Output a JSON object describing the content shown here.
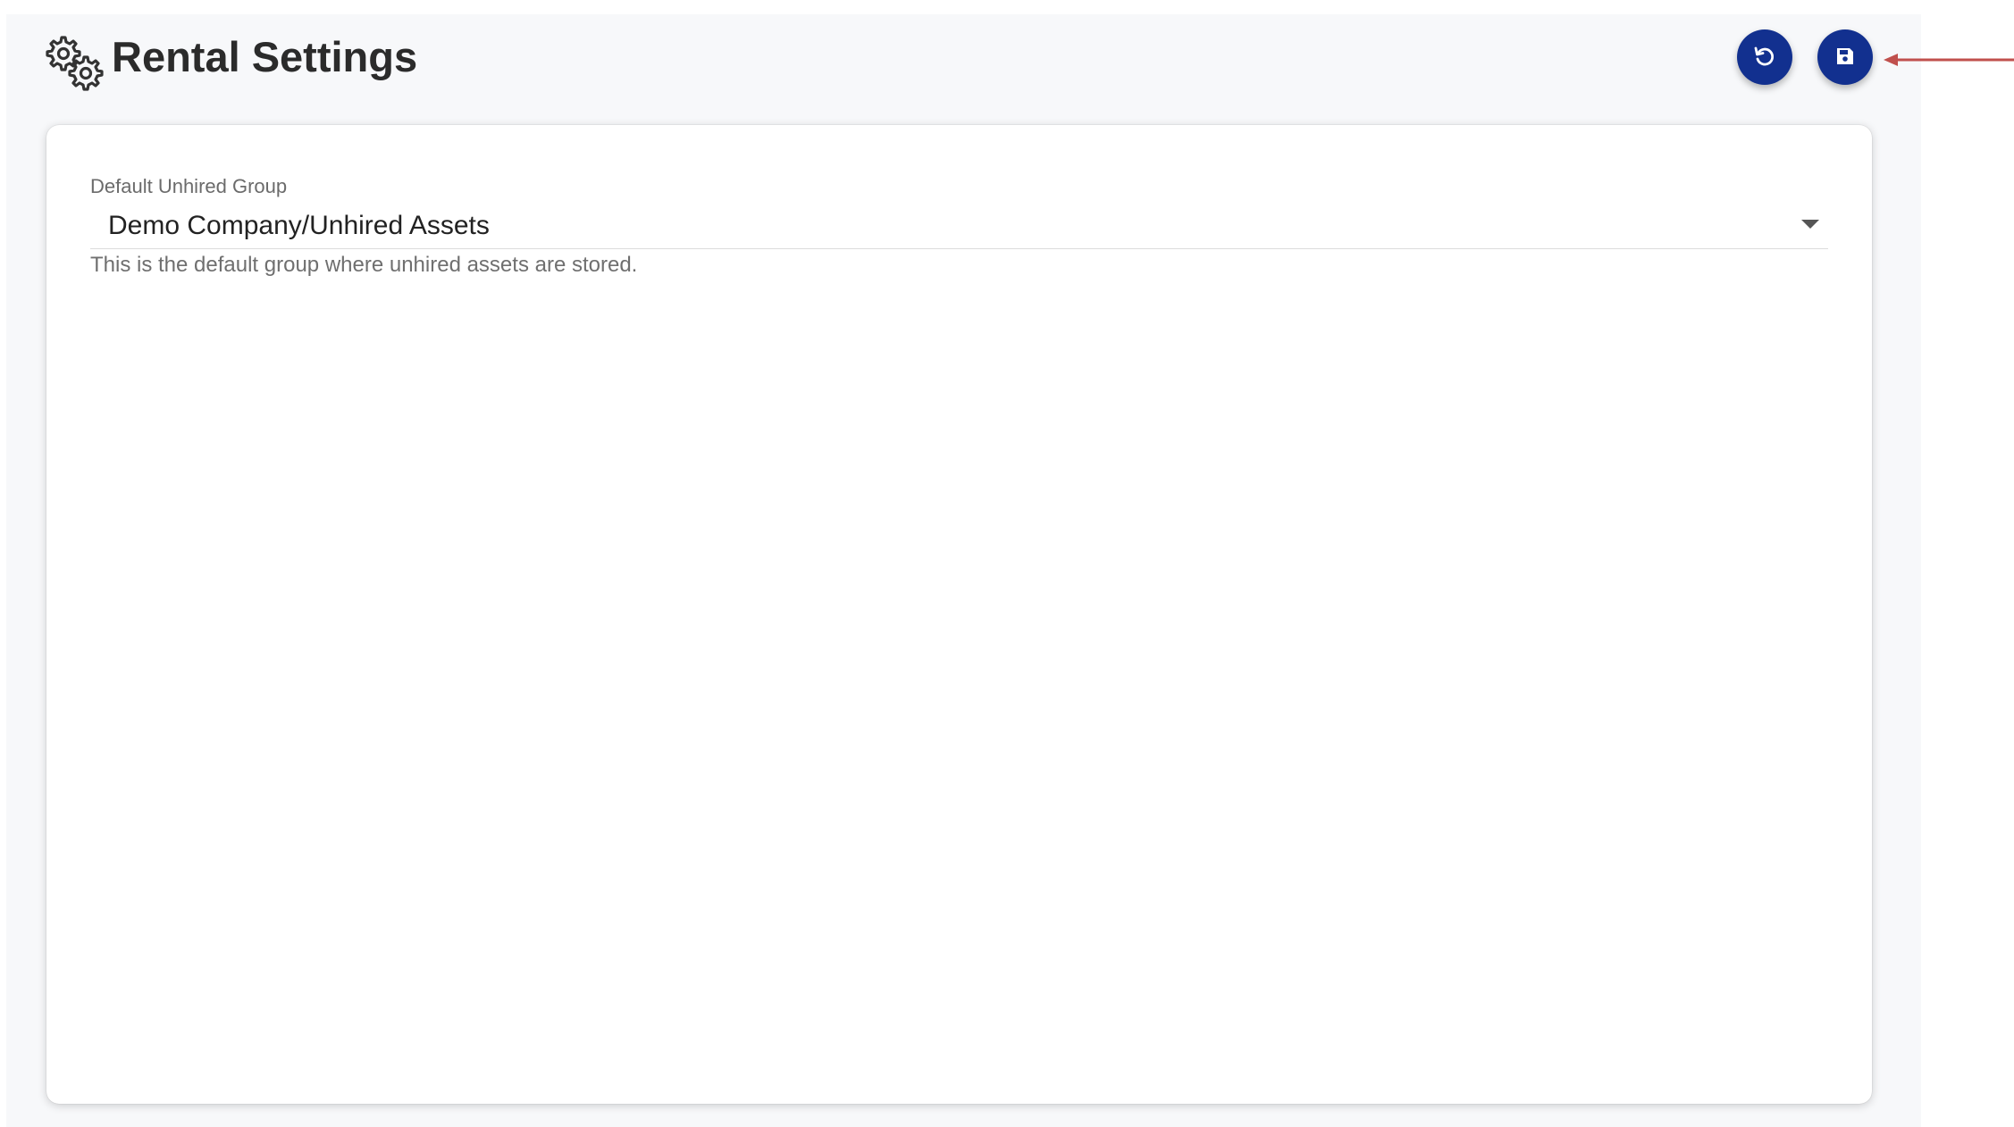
{
  "header": {
    "title": "Rental Settings",
    "icon": "gears-icon"
  },
  "actions": {
    "reset_icon": "undo-icon",
    "save_icon": "save-icon"
  },
  "form": {
    "default_unhired_group": {
      "label": "Default Unhired Group",
      "value": "Demo Company/Unhired Assets",
      "helper": "This is the default group where unhired assets are stored."
    }
  },
  "colors": {
    "primary": "#12308f",
    "annotation": "#c0504d",
    "background": "#f7f8fa"
  }
}
